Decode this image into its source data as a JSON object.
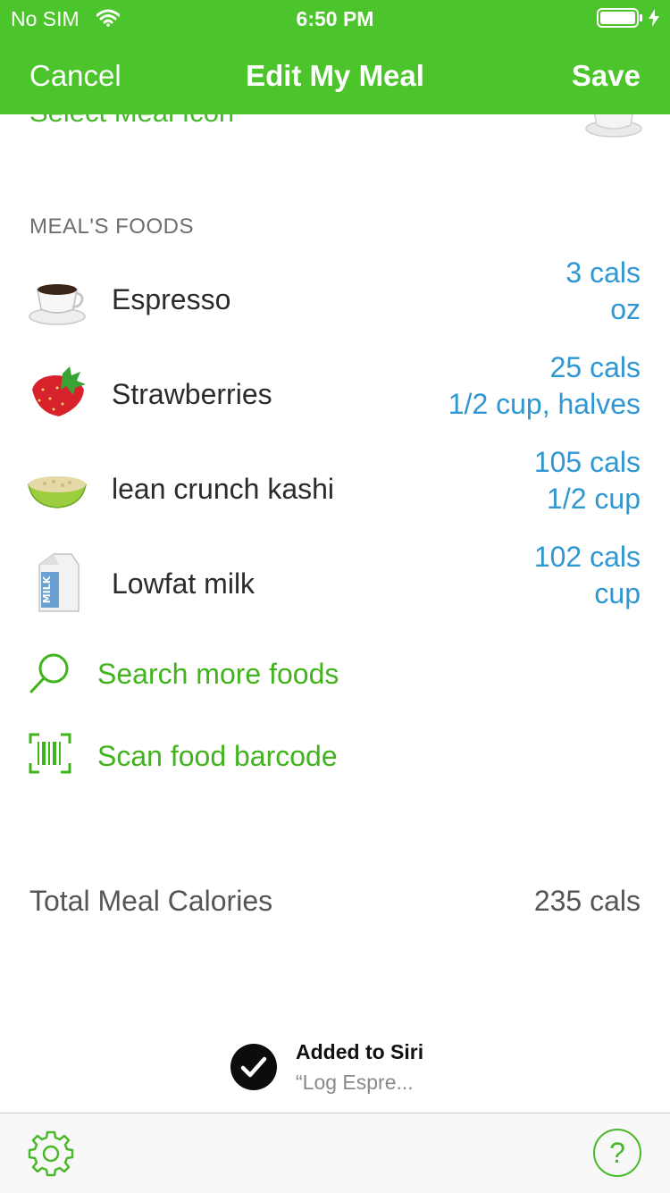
{
  "status_bar": {
    "carrier": "No SIM",
    "time": "6:50 PM"
  },
  "nav": {
    "cancel_label": "Cancel",
    "title": "Edit My Meal",
    "save_label": "Save"
  },
  "meal_icon": {
    "label": "Select Meal Icon"
  },
  "section": {
    "foods_header": "MEAL'S FOODS"
  },
  "foods": [
    {
      "name": "Espresso",
      "calories": "3 cals",
      "serving": "oz",
      "icon": "espresso-icon"
    },
    {
      "name": "Strawberries",
      "calories": "25 cals",
      "serving": "1/2 cup, halves",
      "icon": "strawberry-icon"
    },
    {
      "name": "lean crunch kashi",
      "calories": "105 cals",
      "serving": "1/2 cup",
      "icon": "cereal-bowl-icon"
    },
    {
      "name": "Lowfat milk",
      "calories": "102 cals",
      "serving": "cup",
      "icon": "milk-carton-icon"
    }
  ],
  "actions": {
    "search_label": "Search more foods",
    "scan_label": "Scan food barcode"
  },
  "total": {
    "label": "Total Meal Calories",
    "value": "235 cals"
  },
  "siri": {
    "title": "Added to Siri",
    "subtitle": "“Log Espre..."
  },
  "tab_bar": {
    "help_glyph": "?"
  },
  "colors": {
    "brand_green": "#4cc42c",
    "link_blue": "#2f97d2",
    "action_green": "#41b41d"
  }
}
